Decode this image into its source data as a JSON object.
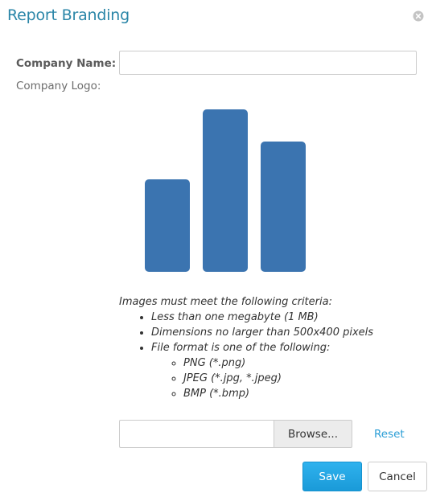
{
  "dialog": {
    "title": "Report Branding",
    "close_icon": "close-circle-icon"
  },
  "form": {
    "company_name_label": "Company Name:",
    "company_name_value": "",
    "company_logo_label": "Company Logo:"
  },
  "logo": {
    "icon": "bar-chart-logo-icon",
    "color": "#3b74b0"
  },
  "criteria": {
    "intro": "Images must meet the following criteria:",
    "items": [
      "Less than one megabyte (1 MB)",
      "Dimensions no larger than 500x400 pixels",
      "File format is one of the following:"
    ],
    "formats": [
      "PNG (*.png)",
      "JPEG (*.jpg, *.jpeg)",
      "BMP (*.bmp)"
    ]
  },
  "upload": {
    "file_value": "",
    "browse_label": "Browse...",
    "reset_label": "Reset"
  },
  "actions": {
    "save_label": "Save",
    "cancel_label": "Cancel"
  },
  "colors": {
    "title": "#2b86a8",
    "primary": "#1a9ad8",
    "link": "#2b9ed6"
  }
}
